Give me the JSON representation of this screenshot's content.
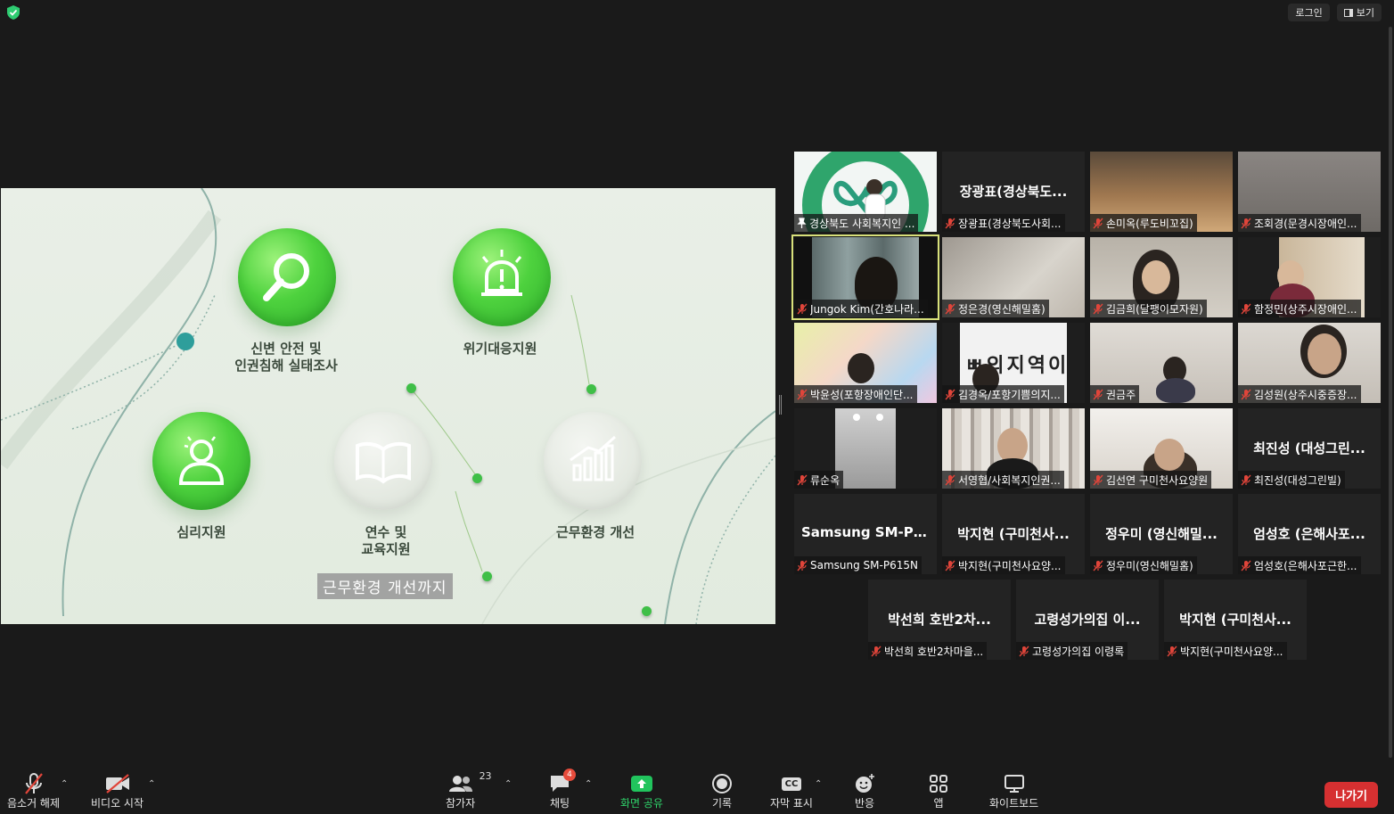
{
  "top": {
    "login_label": "로그인",
    "view_label": "보기"
  },
  "share": {
    "labels": [
      "신변 안전 및\n인권침해 실태조사",
      "위기대응지원",
      "심리지원",
      "연수 및\n교육지원",
      "근무환경 개선"
    ],
    "caption": "근무환경 개선까지"
  },
  "tiles": [
    {
      "center": "",
      "name": "경상북도 사회복지인 ...",
      "muted": false,
      "pinned": true
    },
    {
      "center": "장광표(경상북도...",
      "name": "장광표(경상북도사회...",
      "muted": true
    },
    {
      "center": "",
      "name": "손미옥(루도비꼬집)",
      "muted": true
    },
    {
      "center": "",
      "name": "조회경(문경시장애인...",
      "muted": true
    },
    {
      "center": "",
      "name": "Jungok Kim(간호나라...",
      "muted": true,
      "active": true
    },
    {
      "center": "",
      "name": "정은경(영신해밀홈)",
      "muted": true
    },
    {
      "center": "",
      "name": "김금희(달팽이모자원)",
      "muted": true
    },
    {
      "center": "",
      "name": "함정민(상주시장애인...",
      "muted": true
    },
    {
      "center": "",
      "name": "박윤성(포항장애인단...",
      "muted": true
    },
    {
      "center": "",
      "name": "김경옥/포항기쁨의지...",
      "muted": true
    },
    {
      "center": "",
      "name": "권금주",
      "muted": true
    },
    {
      "center": "",
      "name": "김성원(상주시중증장...",
      "muted": true
    },
    {
      "center": "",
      "name": "류순옥",
      "muted": true
    },
    {
      "center": "",
      "name": "서영협/사회복지인권...",
      "muted": true
    },
    {
      "center": "",
      "name": "김선연 구미천사요양원",
      "muted": true
    },
    {
      "center": "최진성 (대성그린...",
      "name": "최진성(대성그린빌)",
      "muted": true
    },
    {
      "center": "Samsung SM-P6...",
      "name": "Samsung SM-P615N",
      "muted": true
    },
    {
      "center": "박지현 (구미천사...",
      "name": "박지현(구미천사요양...",
      "muted": true
    },
    {
      "center": "정우미 (영신해밀...",
      "name": "정우미(영신해밀홈)",
      "muted": true
    },
    {
      "center": "엄성호 (은해사포...",
      "name": "엄성호(은해사포근한...",
      "muted": true
    },
    {
      "center": "박선희 호반2차...",
      "name": "박선희 호반2차마을...",
      "muted": true
    },
    {
      "center": "고령성가의집 이...",
      "name": "고령성가의집 이령록",
      "muted": true
    },
    {
      "center": "박지현 (구미천사...",
      "name": "박지현(구미천사요양...",
      "muted": true
    }
  ],
  "toolbar": {
    "unmute": "음소거 해제",
    "start_video": "비디오 시작",
    "participants": "참가자",
    "participants_count": "23",
    "chat": "채팅",
    "chat_badge": "4",
    "share_screen": "화면 공유",
    "record": "기록",
    "captions": "자막 표시",
    "cc_icon_text": "CC",
    "reactions": "반응",
    "apps": "앱",
    "whiteboard": "화이트보드",
    "leave": "나가기"
  },
  "colors": {
    "accent_green": "#21c45d",
    "leave_red": "#d63031",
    "mute_red": "#e0453a"
  }
}
